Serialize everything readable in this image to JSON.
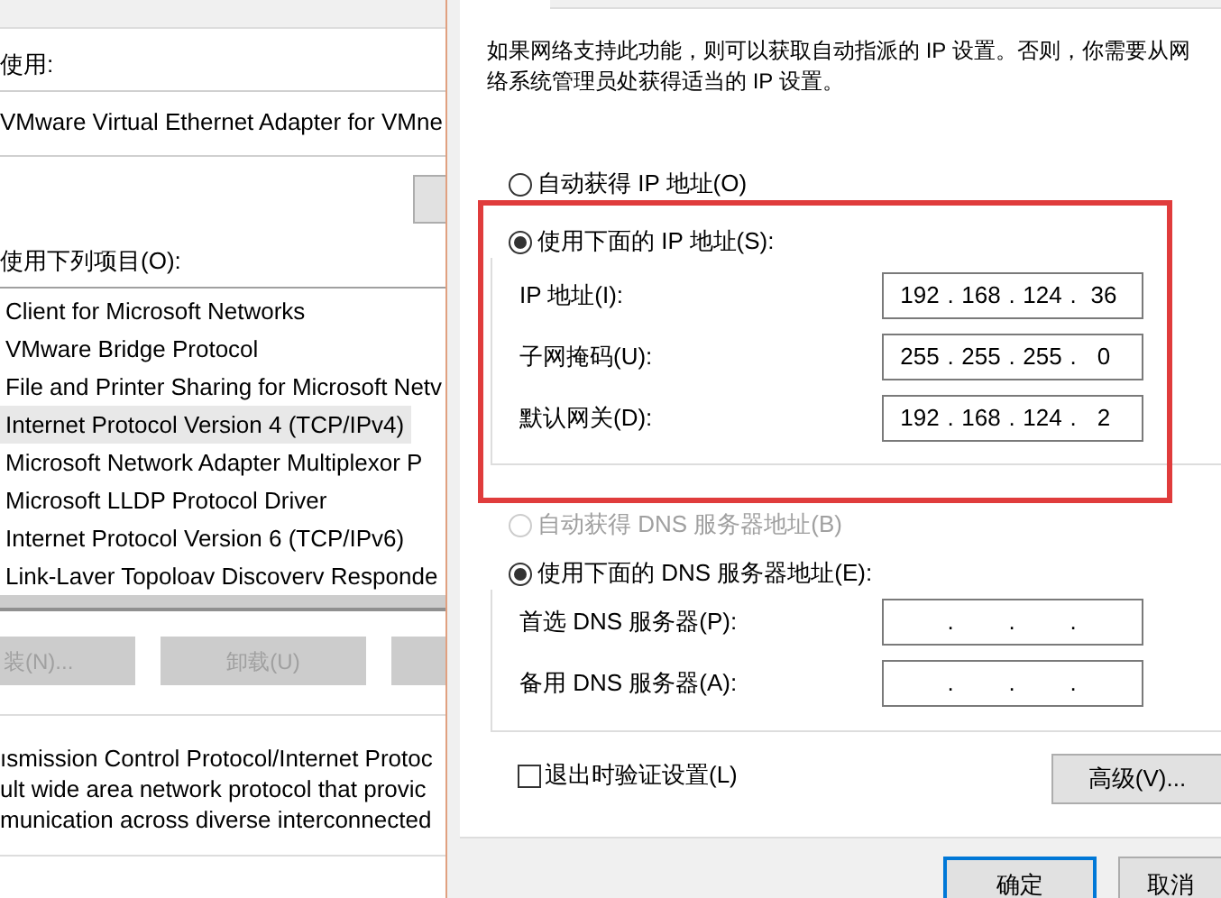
{
  "left_window": {
    "connect_label": "使用:",
    "adapter": "VMware Virtual Ethernet Adapter for VMne",
    "items_label": "使用下列项目(O):",
    "items": [
      {
        "label": "Client for Microsoft Networks",
        "selected": false
      },
      {
        "label": "VMware Bridge Protocol",
        "selected": false
      },
      {
        "label": "File and Printer Sharing for Microsoft Netv",
        "selected": false
      },
      {
        "label": "Internet Protocol Version 4 (TCP/IPv4)",
        "selected": true
      },
      {
        "label": "Microsoft Network Adapter Multiplexor P",
        "selected": false
      },
      {
        "label": "Microsoft LLDP Protocol Driver",
        "selected": false
      },
      {
        "label": "Internet Protocol Version 6 (TCP/IPv6)",
        "selected": false
      },
      {
        "label": "Link-Laver Topoloav Discoverv Responde",
        "selected": false
      }
    ],
    "buttons": [
      {
        "label": "装(N)...",
        "disabled": true
      },
      {
        "label": "卸载(U)",
        "disabled": true
      }
    ],
    "description": [
      "ısmission Control Protocol/Internet Protoc",
      "ult wide area network protocol that provic",
      "munication across diverse interconnected"
    ]
  },
  "ipv4_window": {
    "intro": "如果网络支持此功能，则可以获取自动指派的 IP 设置。否则，你需要从网络系统管理员处获得适当的 IP 设置。",
    "ip_options": [
      {
        "label": "自动获得 IP 地址(O)",
        "selected": false,
        "disabled": false
      },
      {
        "label": "使用下面的 IP 地址(S):",
        "selected": true,
        "disabled": false
      }
    ],
    "ip_fields": [
      {
        "label": "IP 地址(I):",
        "octets": [
          "192",
          "168",
          "124",
          "36"
        ],
        "separators": [
          ".",
          ".",
          "."
        ]
      },
      {
        "label": "子网掩码(U):",
        "octets": [
          "255",
          "255",
          "255",
          "0"
        ],
        "separators": [
          ".",
          ".",
          "."
        ]
      },
      {
        "label": "默认网关(D):",
        "octets": [
          "192",
          "168",
          "124",
          "2"
        ],
        "separators": [
          ".",
          ".",
          "."
        ]
      }
    ],
    "dns_options": [
      {
        "label": "自动获得 DNS 服务器地址(B)",
        "selected": false,
        "disabled": true
      },
      {
        "label": "使用下面的 DNS 服务器地址(E):",
        "selected": true,
        "disabled": false
      }
    ],
    "dns_fields": [
      {
        "label": "首选 DNS 服务器(P):",
        "separators": [
          ".",
          ".",
          "."
        ]
      },
      {
        "label": "备用 DNS 服务器(A):",
        "separators": [
          ".",
          ".",
          "."
        ]
      }
    ],
    "validate": {
      "label": "退出时验证设置(L)",
      "checked": false
    },
    "advanced_button": "高级(V)...",
    "ok_button": "确定",
    "cancel_button": "取消"
  }
}
